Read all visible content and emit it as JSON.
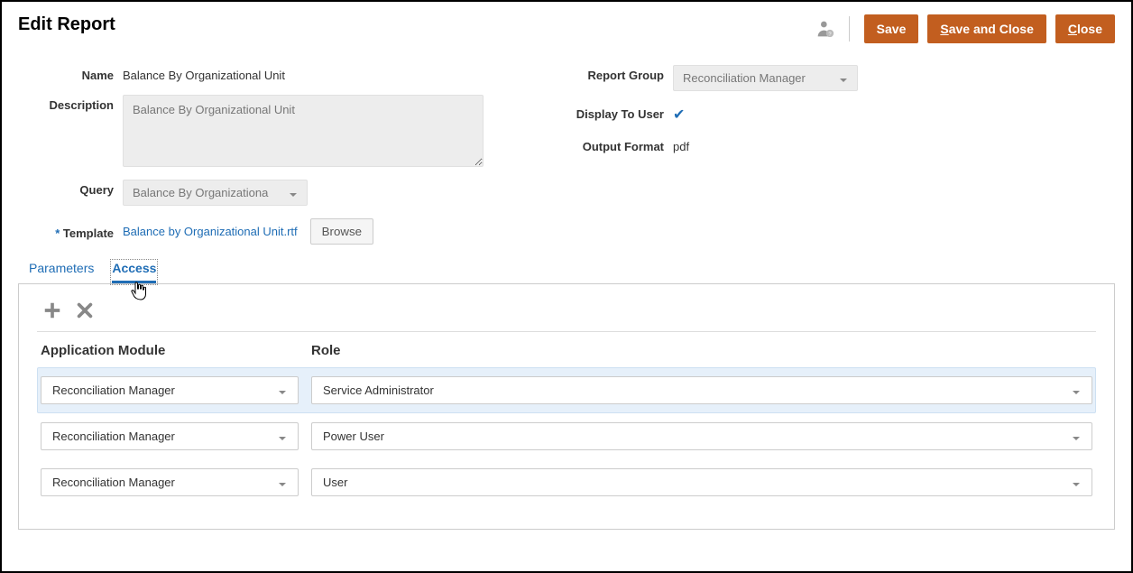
{
  "header": {
    "title": "Edit Report",
    "save": "Save",
    "save_close": "Save and Close",
    "close": "Close"
  },
  "form": {
    "name_label": "Name",
    "name_value": "Balance By Organizational Unit",
    "description_label": "Description",
    "description_value": "Balance By Organizational Unit",
    "query_label": "Query",
    "query_value": "Balance By Organizationa",
    "template_label": "Template",
    "template_value": "Balance by Organizational Unit.rtf",
    "browse": "Browse",
    "report_group_label": "Report Group",
    "report_group_value": "Reconciliation Manager",
    "display_to_user_label": "Display To User",
    "output_format_label": "Output Format",
    "output_format_value": "pdf"
  },
  "tabs": {
    "parameters": "Parameters",
    "access": "Access"
  },
  "grid": {
    "col_module": "Application Module",
    "col_role": "Role",
    "rows": [
      {
        "module": "Reconciliation Manager",
        "role": "Service Administrator"
      },
      {
        "module": "Reconciliation Manager",
        "role": "Power User"
      },
      {
        "module": "Reconciliation Manager",
        "role": "User"
      }
    ]
  }
}
